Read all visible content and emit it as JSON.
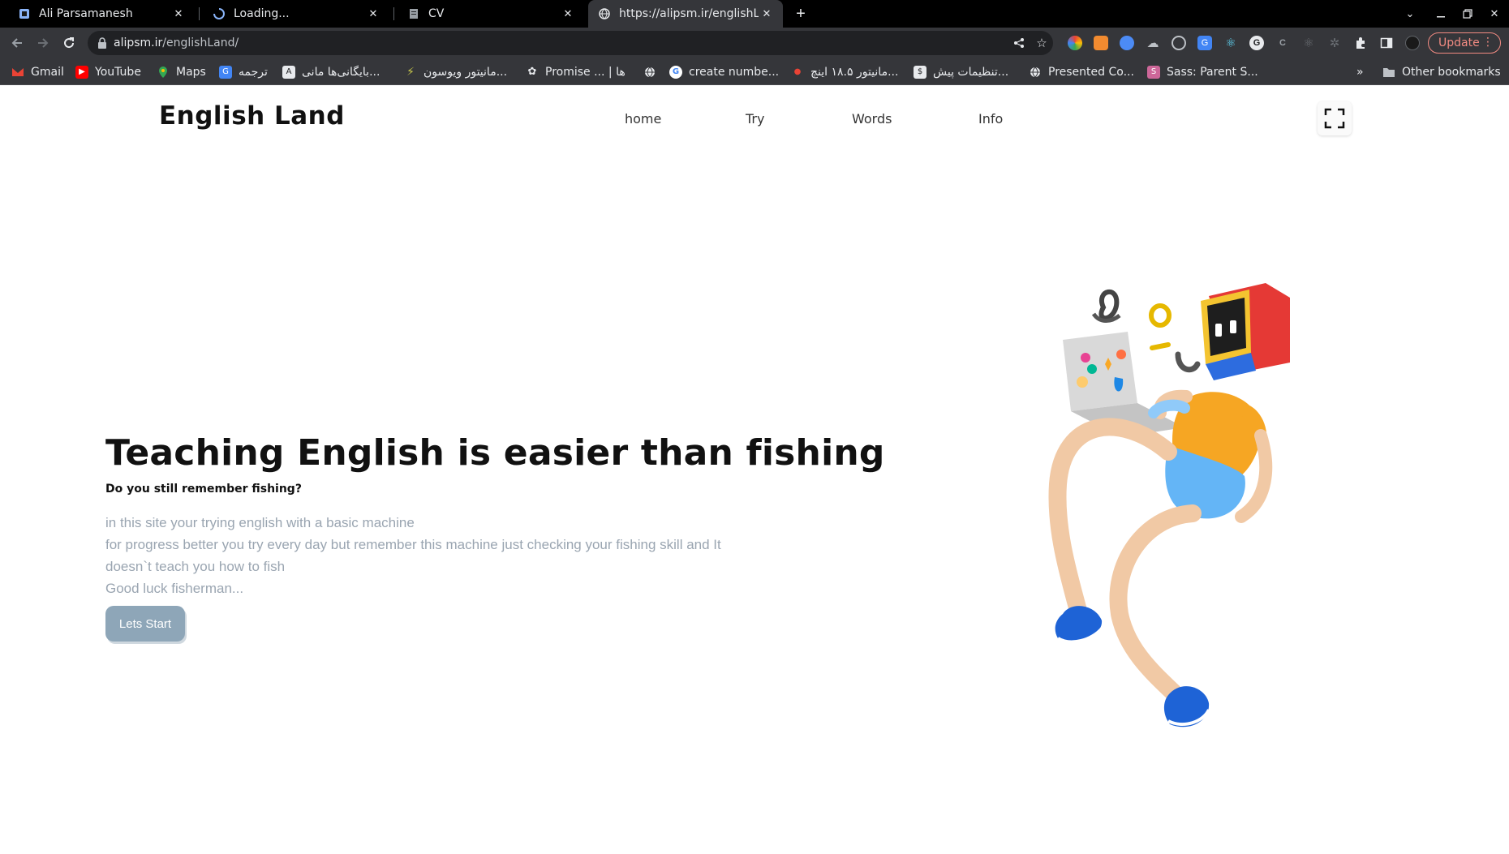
{
  "browser": {
    "tabs": [
      {
        "title": "Ali Parsamanesh",
        "active": false
      },
      {
        "title": "Loading...",
        "active": false
      },
      {
        "title": "CV",
        "active": false
      },
      {
        "title": "https://alipsm.ir/englishL",
        "active": true
      }
    ],
    "address": {
      "host": "alipsm.ir",
      "path": "/englishLand/"
    },
    "update_label": "Update",
    "bookmarks": [
      {
        "label": "Gmail",
        "icon": "gmail-icon"
      },
      {
        "label": "YouTube",
        "icon": "youtube-icon"
      },
      {
        "label": "Maps",
        "icon": "maps-icon"
      },
      {
        "label": "ترجمه",
        "icon": "translate-icon"
      },
      {
        "label": "بایگانی‌ها مانی...",
        "icon": "archive-icon"
      },
      {
        "label": "مانیتور ویوسون...",
        "icon": "monitor-icon"
      },
      {
        "label": "Promise ... | ها",
        "icon": "promise-icon"
      },
      {
        "label": "",
        "icon": "globe-icon"
      },
      {
        "label": "create numbe...",
        "icon": "google-icon"
      },
      {
        "label": "مانیتور ۱۸.۵ اینچ...",
        "icon": "monitor-icon"
      },
      {
        "label": "تنظیمات پیش...",
        "icon": "settings-icon"
      },
      {
        "label": "Presented Co...",
        "icon": "globe-icon"
      },
      {
        "label": "Sass: Parent S...",
        "icon": "sass-icon"
      }
    ],
    "other_bookmarks": "Other bookmarks"
  },
  "site": {
    "logo": "English Land",
    "nav": [
      "home",
      "Try",
      "Words",
      "Info"
    ]
  },
  "hero": {
    "title": "Teaching English is easier than fishing",
    "subtitle": "Do you still remember fishing?",
    "lines": [
      "in this site your trying english with a basic machine",
      "for progress better you try every day but remember this machine just checking your fishing skill and It",
      "doesn`t teach you how to fish",
      "Good luck fisherman..."
    ],
    "button": "Lets Start"
  },
  "colors": {
    "button_bg": "#8ea6b8",
    "text_muted": "#9aa5b1",
    "chrome_bg": "#35363a",
    "tabbar_bg": "#000000",
    "update_accent": "#f28b82"
  }
}
